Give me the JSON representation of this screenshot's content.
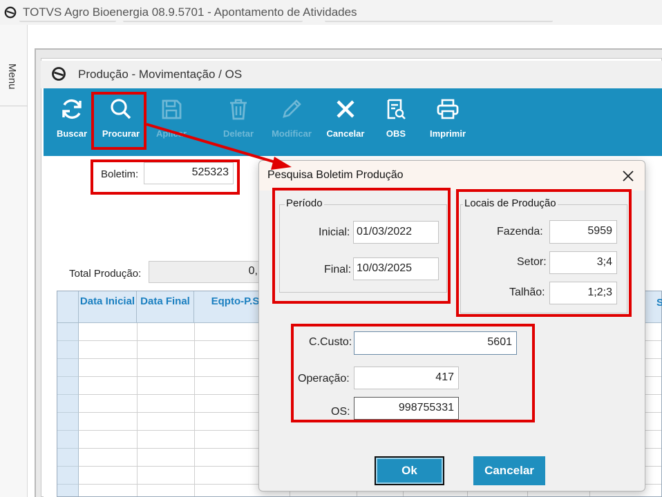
{
  "app": {
    "title": "TOTVS Agro Bioenergia 08.9.5701 - Apontamento de Atividades"
  },
  "sidebar": {
    "menu_label": "Menu"
  },
  "window": {
    "title": "Produção - Movimentação / OS"
  },
  "toolbar": {
    "buttons": [
      {
        "label": "Buscar",
        "icon": "refresh-icon",
        "enabled": true
      },
      {
        "label": "Procurar",
        "icon": "search-icon",
        "enabled": true
      },
      {
        "label": "Aplicar",
        "icon": "save-icon",
        "enabled": false
      },
      {
        "label": "Deletar",
        "icon": "trash-icon",
        "enabled": false
      },
      {
        "label": "Modificar",
        "icon": "pencil-icon",
        "enabled": false
      },
      {
        "label": "Cancelar",
        "icon": "close-icon",
        "enabled": true
      },
      {
        "label": "OBS",
        "icon": "document-search-icon",
        "enabled": true
      },
      {
        "label": "Imprimir",
        "icon": "printer-icon",
        "enabled": true
      }
    ],
    "accent_color": "#1b8fbf"
  },
  "form": {
    "boletim_label": "Boletim:",
    "boletim_value": "525323",
    "total_producao_label": "Total Produção:",
    "total_producao_value": "0,"
  },
  "grid": {
    "columns": [
      "Data Inicial",
      "Data Final",
      "Eqpto-P.S"
    ],
    "right_edge_header": "S"
  },
  "dialog": {
    "title": "Pesquisa Boletim Produção",
    "periodo": {
      "legend": "Período",
      "inicial_label": "Inicial:",
      "inicial_value": "01/03/2022",
      "final_label": "Final:",
      "final_value": "10/03/2025"
    },
    "locais": {
      "legend": "Locais de Produção",
      "fazenda_label": "Fazenda:",
      "fazenda_value": "5959",
      "setor_label": "Setor:",
      "setor_value": "3;4",
      "talhao_label": "Talhão:",
      "talhao_value": "1;2;3"
    },
    "ccusto_label": "C.Custo:",
    "ccusto_value": "5601",
    "operacao_label": "Operação:",
    "operacao_value": "417",
    "os_label": "OS:",
    "os_value": "998755331",
    "ok_label": "Ok",
    "cancel_label": "Cancelar"
  },
  "annotation": {
    "highlight_color": "#e00000"
  }
}
